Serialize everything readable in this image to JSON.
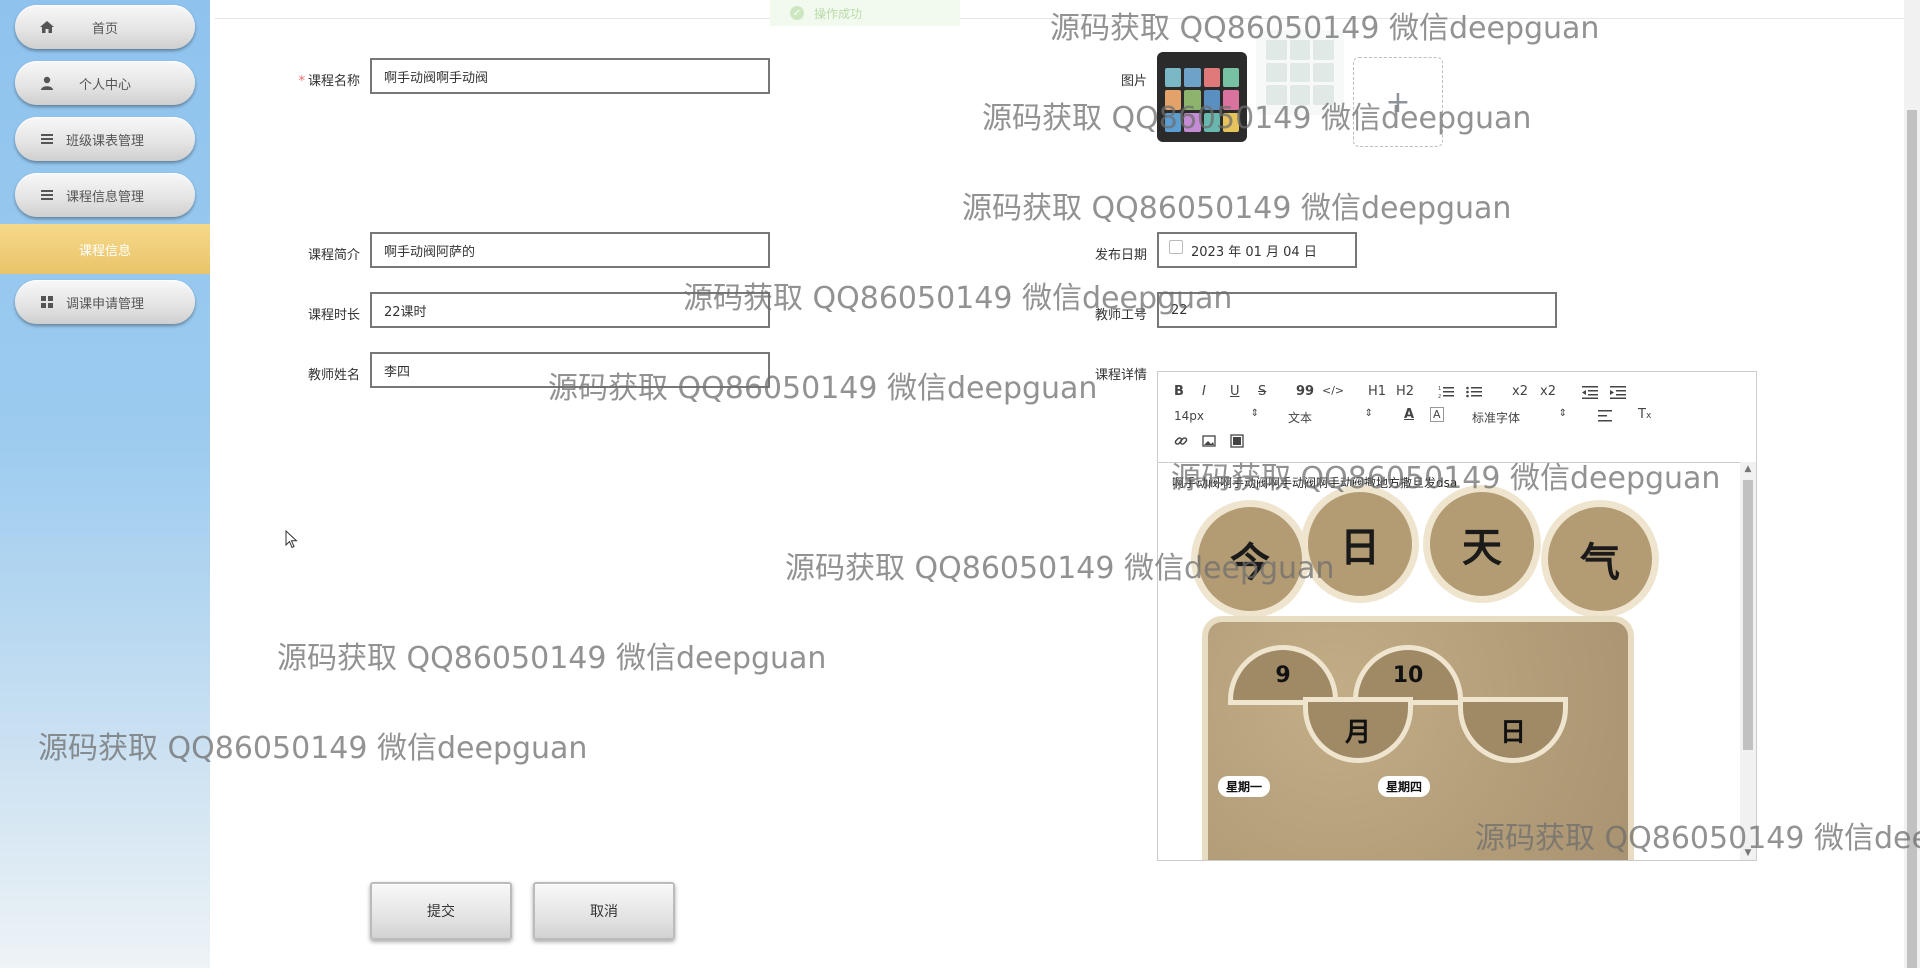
{
  "sidebar": {
    "items": [
      {
        "label": "首页",
        "icon": "home-icon"
      },
      {
        "label": "个人中心",
        "icon": "user-icon"
      },
      {
        "label": "班级课表管理",
        "icon": "menu-icon"
      },
      {
        "label": "课程信息管理",
        "icon": "menu-icon"
      },
      {
        "label": "课程信息"
      },
      {
        "label": "调课申请管理",
        "icon": "grid-icon"
      }
    ]
  },
  "toast": {
    "text": "操作成功"
  },
  "form": {
    "course_name": {
      "label": "课程名称",
      "value": "啊手动阀啊手动阀"
    },
    "image": {
      "label": "图片",
      "upload_icon": "+"
    },
    "intro": {
      "label": "课程简介",
      "value": "啊手动阀阿萨的"
    },
    "publish_date": {
      "label": "发布日期",
      "value": "2023 年 01 月 04 日"
    },
    "duration": {
      "label": "课程时长",
      "value": "22课时"
    },
    "teacher_id": {
      "label": "教师工号",
      "value": "22"
    },
    "teacher_name": {
      "label": "教师姓名",
      "value": "李四"
    },
    "details": {
      "label": "课程详情",
      "toolbar": {
        "font_size": "14px",
        "header": "文本",
        "font_family": "标准字体",
        "buttons": [
          "B",
          "I",
          "U",
          "S",
          "99",
          "</>",
          "H1",
          "H2",
          "x2",
          "x2"
        ]
      },
      "content_text": "啊手动阀啊手动阀啊手动阀啊手动阀撒地方撒旦发dsa",
      "image_text": {
        "discs": [
          "今",
          "日",
          "天",
          "气"
        ],
        "month_num": "9",
        "day_num": "10",
        "month": "月",
        "day": "日",
        "weekday1": "星期一",
        "weekday2": "星期四"
      }
    }
  },
  "buttons": {
    "submit": "提交",
    "cancel": "取消"
  },
  "watermark": "源码获取 QQ86050149 微信deepguan",
  "watermark_clipped": "源码获取 QQ86050149 微信dee",
  "colors": {
    "sidebar_active": "#e9c46a",
    "required": "#f56c6c",
    "success": "#b9dcaa"
  }
}
